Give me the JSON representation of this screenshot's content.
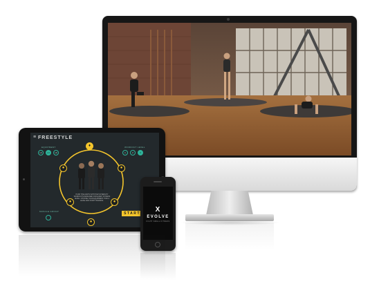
{
  "tablet": {
    "logo_mark": "≡",
    "app_title": "FREESTYLE",
    "left_label": "EQUIPMENT",
    "left_chips": [
      "HI",
      "LO",
      "HI"
    ],
    "right_label": "WORKOUT LEVEL",
    "right_chips": [
      "1",
      "2",
      "3"
    ],
    "bottom_label": "MUSCLE GROUP",
    "description": "PUSH THE LIMITS WITH HIGH INTENSITY WORKOUTS DESIGNED FOR EVERY FITNESS LEVEL. CHOOSE YOUR EQUIPMENT, PICK A LEVEL AND START TRAINING.",
    "start_label": "START"
  },
  "phone": {
    "logo_mark": "X",
    "brand": "EVOLVE",
    "tagline": "FIGHT SMALL FITNESS"
  },
  "colors": {
    "accent_yellow": "#f4c52c",
    "accent_teal": "#2fb39a",
    "tablet_bg": "#23292c",
    "device_black": "#161616"
  }
}
